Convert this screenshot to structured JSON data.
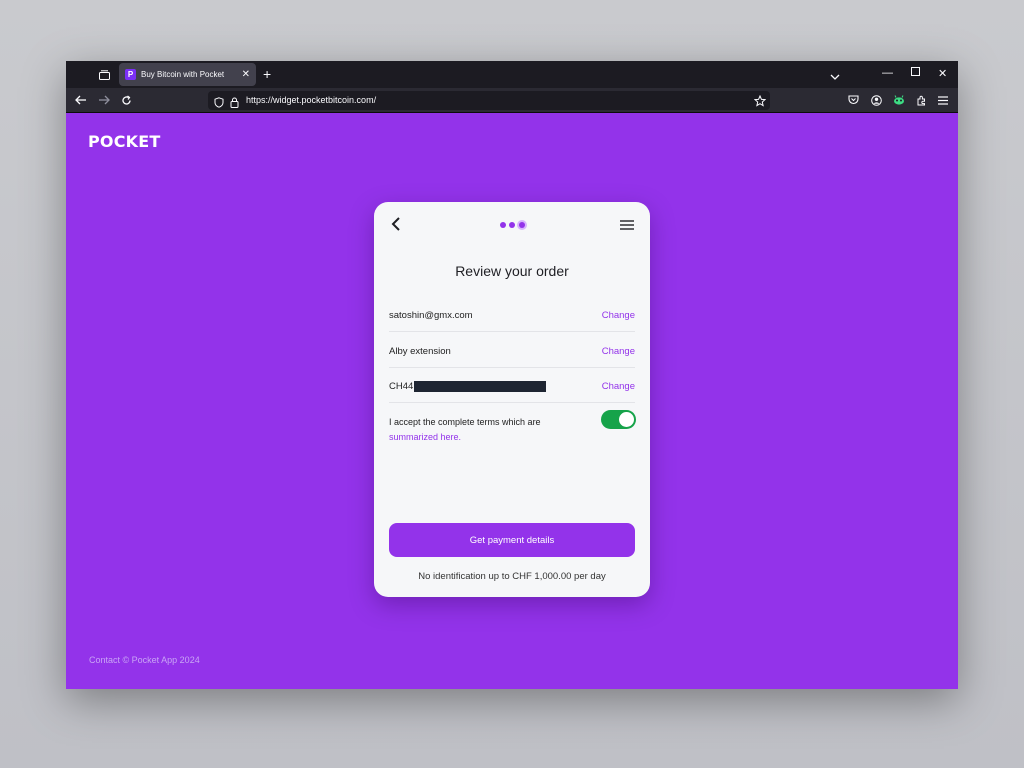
{
  "browser": {
    "tab": {
      "title": "Buy Bitcoin with Pocket",
      "favicon_letter": "P"
    },
    "url": "https://widget.pocketbitcoin.com/",
    "icons": [
      "tab-list-icon",
      "close-icon",
      "plus-icon",
      "chevron-down-icon",
      "minimize-icon",
      "maximize-icon",
      "close-icon",
      "back-arrow-icon",
      "forward-arrow-icon",
      "reload-icon",
      "shield-icon",
      "lock-icon",
      "star-icon",
      "pocket-save-icon",
      "account-icon",
      "extension-alby-icon",
      "extensions-icon",
      "menu-icon"
    ]
  },
  "page": {
    "logo": "POCKET",
    "footer": "Contact © Pocket App 2024",
    "brand_color": "#9333ea"
  },
  "card": {
    "title": "Review your order",
    "rows": [
      {
        "label": "satoshin@gmx.com",
        "action": "Change"
      },
      {
        "label": "Alby extension",
        "action": "Change"
      },
      {
        "label": "CH44",
        "action": "Change"
      }
    ],
    "terms_text": "I accept the complete terms which are",
    "terms_link": "summarized here",
    "terms_link_suffix": ".",
    "terms_accepted": true,
    "cta_label": "Get payment details",
    "limit_note": "No identification up to CHF 1,000.00 per day",
    "progress_step": 3,
    "progress_total": 3
  }
}
